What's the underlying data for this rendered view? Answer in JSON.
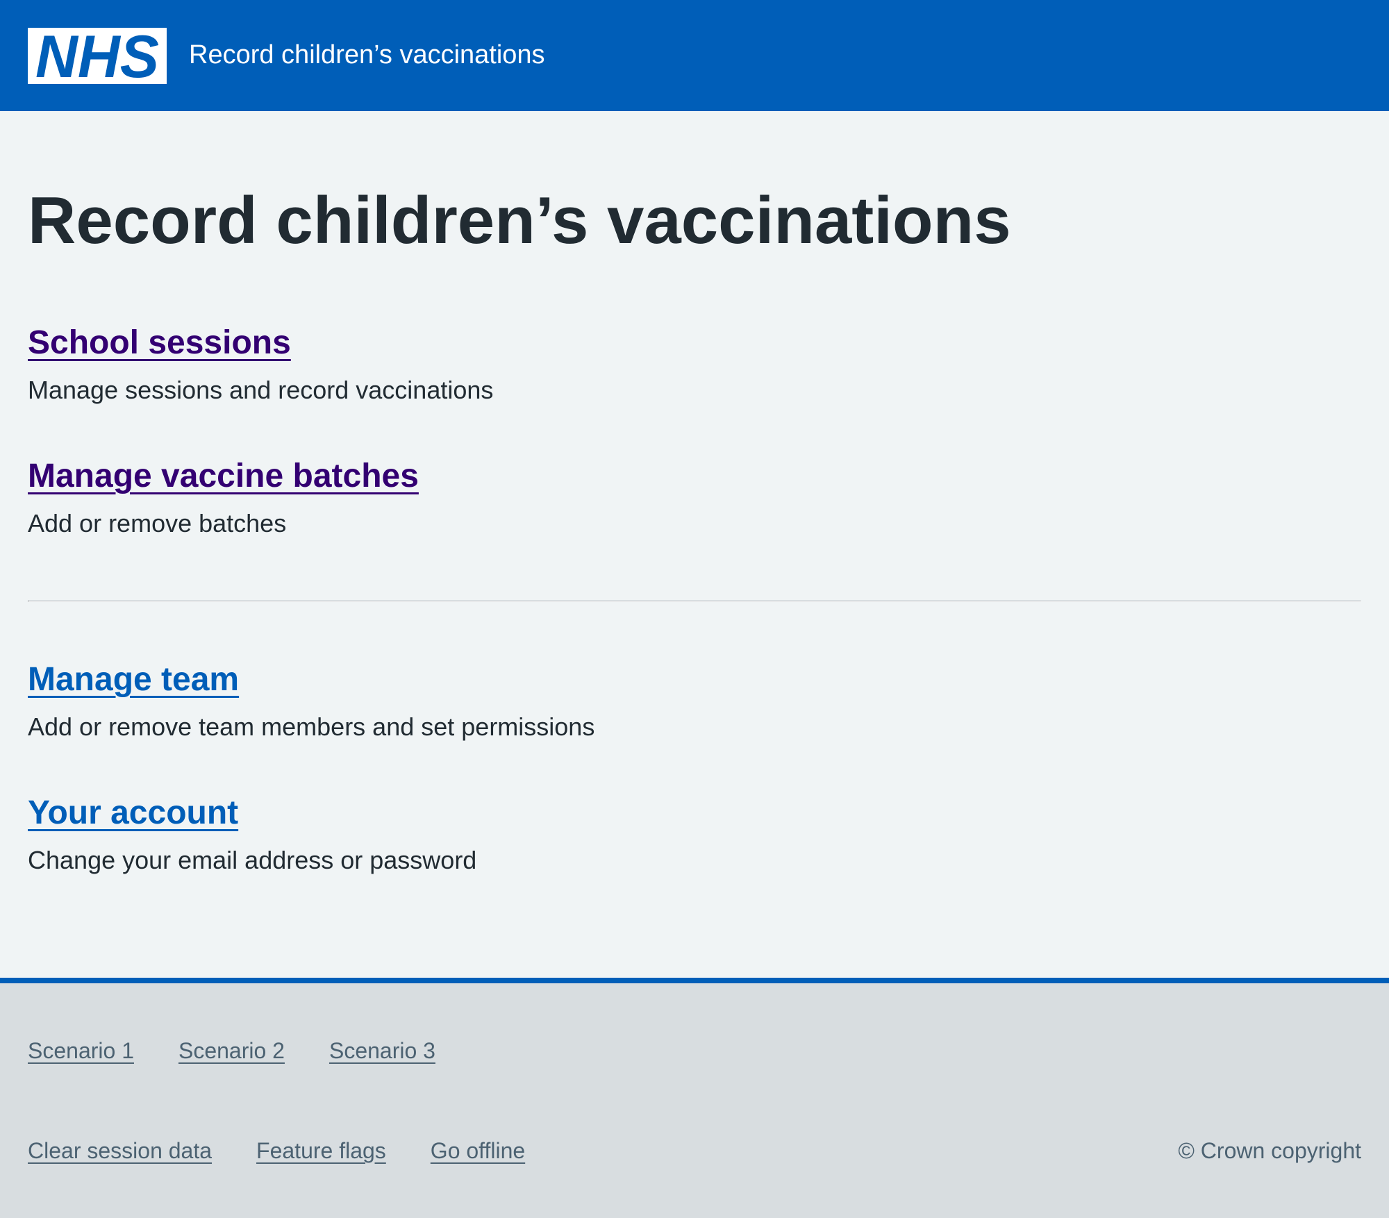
{
  "header": {
    "logo_text": "NHS",
    "service_name": "Record children’s vaccinations",
    "brand_color": "#005eb8"
  },
  "main": {
    "title": "Record children’s vaccinations",
    "primary_links": [
      {
        "label": "School sessions",
        "description": "Manage sessions and record vaccinations",
        "state": "visited"
      },
      {
        "label": "Manage vaccine batches",
        "description": "Add or remove batches",
        "state": "visited"
      }
    ],
    "secondary_links": [
      {
        "label": "Manage team",
        "description": "Add or remove team members and set permissions",
        "state": "unvisited"
      },
      {
        "label": "Your account",
        "description": "Change your email address or password",
        "state": "unvisited"
      }
    ]
  },
  "footer": {
    "scenario_links": [
      "Scenario 1",
      "Scenario 2",
      "Scenario 3"
    ],
    "utility_links": [
      "Clear session data",
      "Feature flags",
      "Go offline"
    ],
    "copyright": "© Crown copyright"
  },
  "colors": {
    "link": "#005eb8",
    "link_visited": "#330072",
    "text": "#212b32",
    "secondary_text": "#4c6272",
    "page_background": "#f0f4f5",
    "footer_background": "#d8dde0"
  }
}
